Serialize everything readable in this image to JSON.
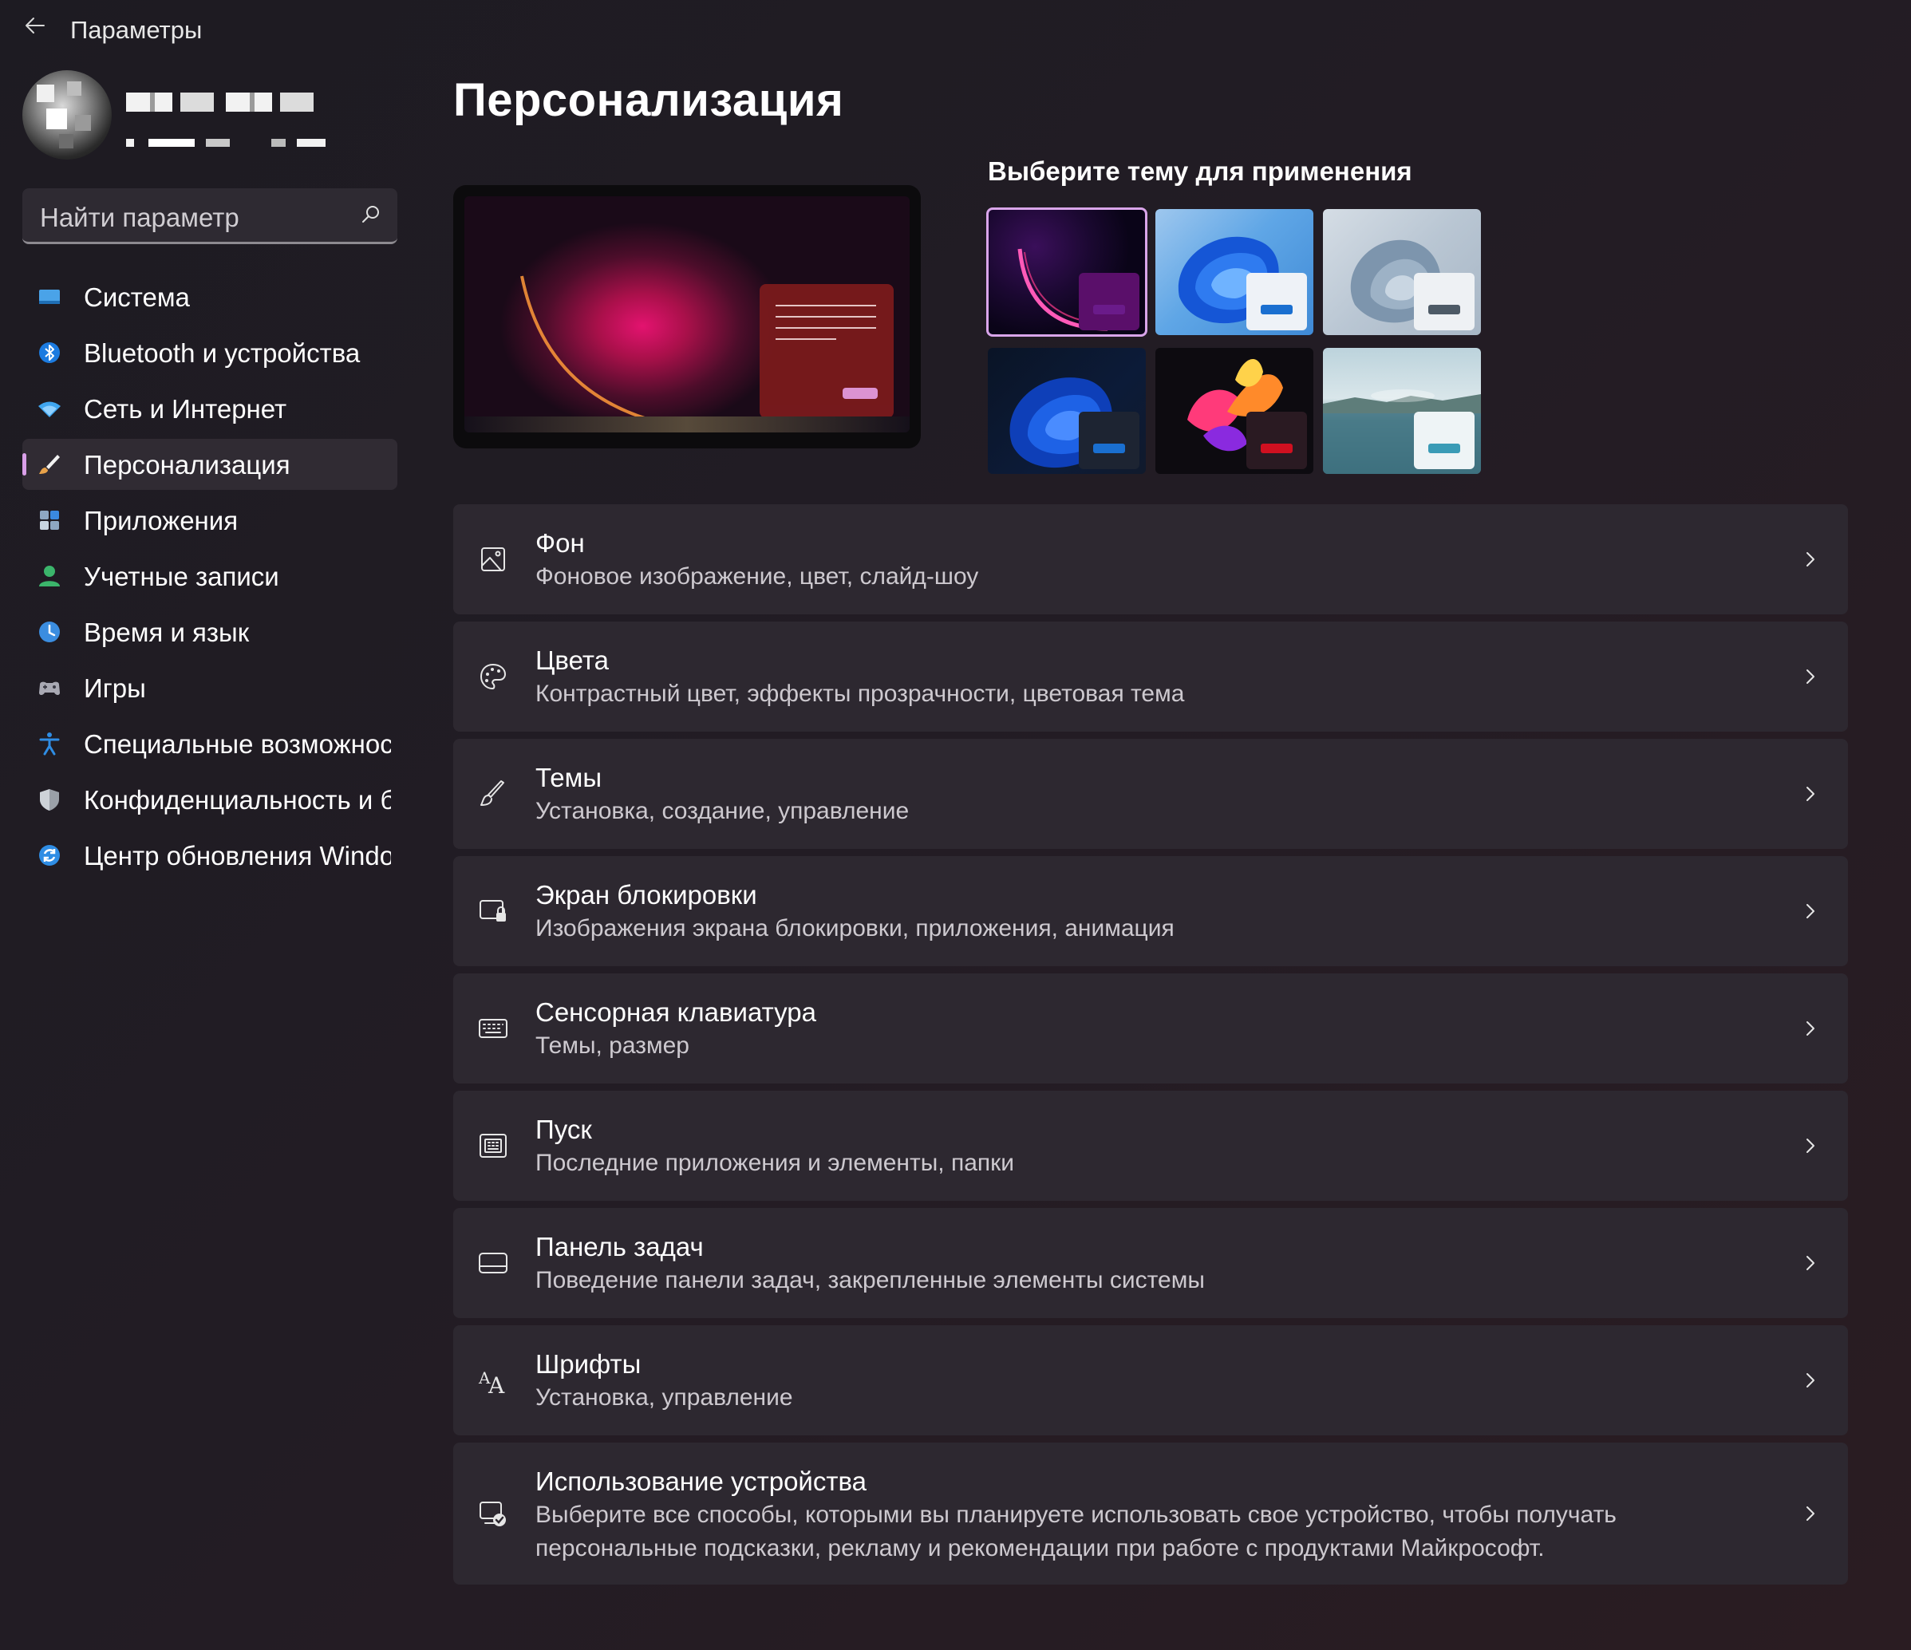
{
  "titlebar": {
    "title": "Параметры"
  },
  "profile": {
    "name": "[redacted]",
    "email": "[redacted]"
  },
  "search": {
    "placeholder": "Найти параметр"
  },
  "sidebar": {
    "items": [
      {
        "label": "Система",
        "icon": "system-icon",
        "color": "#4aa3e8",
        "active": false
      },
      {
        "label": "Bluetooth и устройства",
        "icon": "bluetooth-icon",
        "color": "#1c7be0",
        "active": false
      },
      {
        "label": "Сеть и Интернет",
        "icon": "wifi-icon",
        "color": "#3fa6f0",
        "active": false
      },
      {
        "label": "Персонализация",
        "icon": "brush-icon",
        "color": "#e8a24a",
        "active": true
      },
      {
        "label": "Приложения",
        "icon": "apps-icon",
        "color": "#8ea7c2",
        "active": false
      },
      {
        "label": "Учетные записи",
        "icon": "account-icon",
        "color": "#3bb56b",
        "active": false
      },
      {
        "label": "Время и язык",
        "icon": "globe-clock-icon",
        "color": "#3b8de0",
        "active": false
      },
      {
        "label": "Игры",
        "icon": "gamepad-icon",
        "color": "#a9a9b3",
        "active": false
      },
      {
        "label": "Специальные возможности",
        "icon": "accessibility-icon",
        "color": "#2f8de4",
        "active": false
      },
      {
        "label": "Конфиденциальность и безопасность",
        "icon": "shield-icon",
        "color": "#9aa0a8",
        "active": false
      },
      {
        "label": "Центр обновления Windows",
        "icon": "update-icon",
        "color": "#2f8de4",
        "active": false
      }
    ]
  },
  "main": {
    "title": "Персонализация",
    "themes_heading": "Выберите тему для применения",
    "themes": [
      {
        "name": "theme-glow-dark",
        "accent": "#6a1b8a",
        "window": "#5a0f6a",
        "selected": true
      },
      {
        "name": "theme-bloom-light",
        "accent": "#1a6fd0",
        "window": "#eef2f7",
        "selected": false
      },
      {
        "name": "theme-captured-motion",
        "accent": "#4d5a66",
        "window": "#eef1f4",
        "selected": false
      },
      {
        "name": "theme-bloom-dark",
        "accent": "#1a6fd0",
        "window": "#1d2432",
        "selected": false
      },
      {
        "name": "theme-flow",
        "accent": "#d01020",
        "window": "#2a1a22",
        "selected": false
      },
      {
        "name": "theme-sunrise-lake",
        "accent": "#3a9bb6",
        "window": "#eef4f6",
        "selected": false
      }
    ],
    "settings": [
      {
        "title": "Фон",
        "desc": "Фоновое изображение, цвет, слайд-шоу",
        "icon": "image-icon"
      },
      {
        "title": "Цвета",
        "desc": "Контрастный цвет, эффекты прозрачности, цветовая тема",
        "icon": "palette-icon"
      },
      {
        "title": "Темы",
        "desc": "Установка, создание, управление",
        "icon": "brush-icon"
      },
      {
        "title": "Экран блокировки",
        "desc": "Изображения экрана блокировки, приложения, анимация",
        "icon": "lock-screen-icon"
      },
      {
        "title": "Сенсорная клавиатура",
        "desc": "Темы, размер",
        "icon": "keyboard-icon"
      },
      {
        "title": "Пуск",
        "desc": "Последние приложения и элементы, папки",
        "icon": "start-menu-icon"
      },
      {
        "title": "Панель задач",
        "desc": "Поведение панели задач, закрепленные элементы системы",
        "icon": "taskbar-icon"
      },
      {
        "title": "Шрифты",
        "desc": "Установка, управление",
        "icon": "font-icon"
      },
      {
        "title": "Использование устройства",
        "desc": "Выберите все способы, которыми вы планируете использовать свое устройство, чтобы получать персональные подсказки, рекламу и рекомендации при работе с продуктами Майкрософт.",
        "icon": "device-usage-icon"
      }
    ]
  }
}
